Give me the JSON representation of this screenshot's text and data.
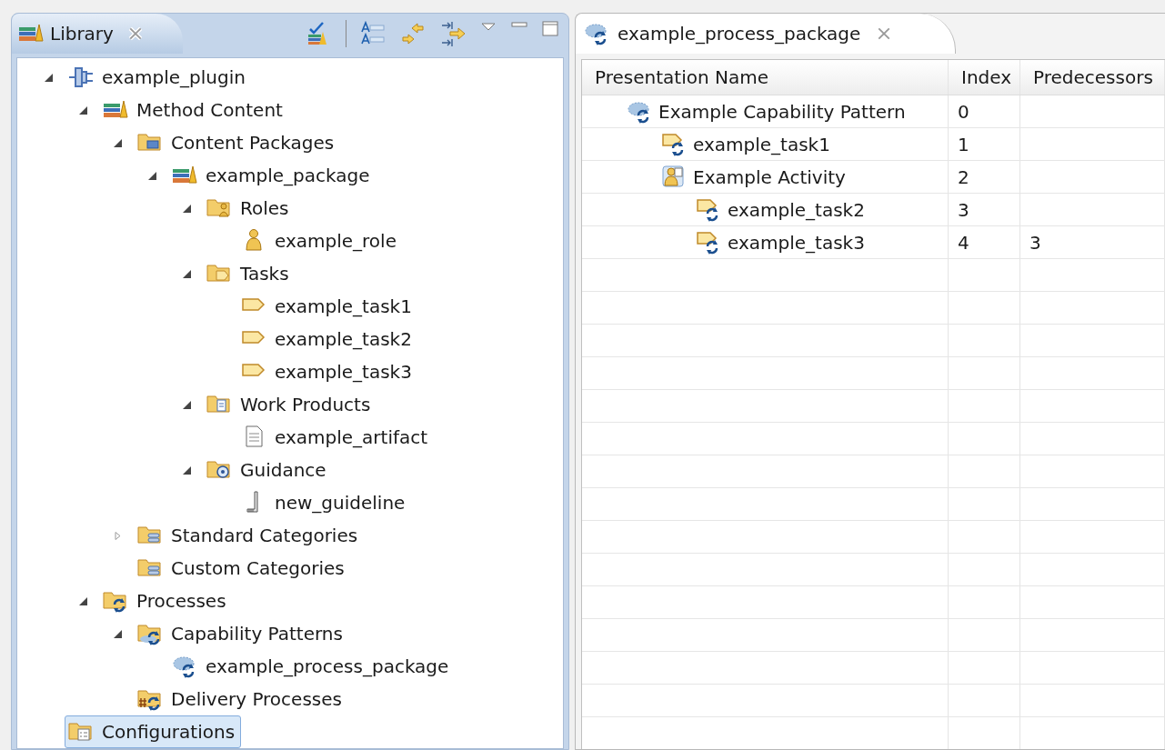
{
  "library_view": {
    "tab": {
      "title": "Library",
      "selected": true
    },
    "tree": [
      {
        "label": "example_plugin",
        "kind": "plugin",
        "expanded": true,
        "selected": false,
        "children": [
          {
            "label": "Method Content",
            "kind": "books",
            "expanded": true,
            "selected": false,
            "children": [
              {
                "label": "Content Packages",
                "kind": "packages-folder",
                "expanded": true,
                "selected": false,
                "children": [
                  {
                    "label": "example_package",
                    "kind": "books",
                    "expanded": true,
                    "selected": false,
                    "children": [
                      {
                        "label": "Roles",
                        "kind": "roles-folder",
                        "expanded": true,
                        "selected": false,
                        "children": [
                          {
                            "label": "example_role",
                            "kind": "role",
                            "selected": false
                          }
                        ]
                      },
                      {
                        "label": "Tasks",
                        "kind": "tasks-folder",
                        "expanded": true,
                        "selected": false,
                        "children": [
                          {
                            "label": "example_task1",
                            "kind": "task",
                            "selected": false
                          },
                          {
                            "label": "example_task2",
                            "kind": "task",
                            "selected": false
                          },
                          {
                            "label": "example_task3",
                            "kind": "task",
                            "selected": false
                          }
                        ]
                      },
                      {
                        "label": "Work Products",
                        "kind": "workproducts-folder",
                        "expanded": true,
                        "selected": false,
                        "children": [
                          {
                            "label": "example_artifact",
                            "kind": "artifact",
                            "selected": false
                          }
                        ]
                      },
                      {
                        "label": "Guidance",
                        "kind": "guidance-folder",
                        "expanded": true,
                        "selected": false,
                        "children": [
                          {
                            "label": "new_guideline",
                            "kind": "guideline",
                            "selected": false
                          }
                        ]
                      }
                    ]
                  }
                ]
              },
              {
                "label": "Standard Categories",
                "kind": "categories-folder",
                "expanded": false,
                "selected": false
              },
              {
                "label": "Custom Categories",
                "kind": "categories-folder",
                "selected": false
              }
            ]
          },
          {
            "label": "Processes",
            "kind": "processes-folder",
            "expanded": true,
            "selected": false,
            "children": [
              {
                "label": "Capability Patterns",
                "kind": "capability-folder",
                "expanded": true,
                "selected": false,
                "children": [
                  {
                    "label": "example_process_package",
                    "kind": "process",
                    "selected": false
                  }
                ]
              },
              {
                "label": "Delivery Processes",
                "kind": "delivery-folder",
                "selected": false
              }
            ]
          }
        ]
      },
      {
        "label": "Configurations",
        "kind": "config-folder",
        "selected": true
      }
    ]
  },
  "editor": {
    "tab": {
      "title": "example_process_package"
    },
    "table": {
      "columns": [
        "Presentation Name",
        "Index",
        "Predecessors"
      ],
      "rows": [
        {
          "name": "Example Capability Pattern",
          "kind": "process",
          "index": "0",
          "children": [
            {
              "name": "example_task1",
              "kind": "task-descriptor",
              "index": "1"
            },
            {
              "name": "Example Activity",
              "kind": "activity",
              "index": "2",
              "children": [
                {
                  "name": "example_task2",
                  "kind": "task-descriptor",
                  "index": "3"
                },
                {
                  "name": "example_task3",
                  "kind": "task-descriptor",
                  "index": "4",
                  "predecessors": "3"
                }
              ]
            }
          ]
        }
      ]
    }
  }
}
